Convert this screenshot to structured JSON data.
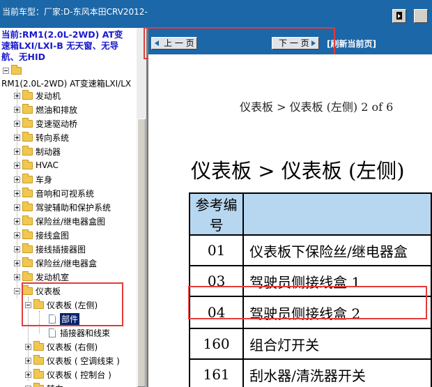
{
  "header": {
    "model_label": "当前车型：",
    "model_value": "厂家:D-东风本田CRV2012-"
  },
  "tree": {
    "vehicle_lines": [
      "当前:RM1(2.0L-2WD) AT变",
      "速箱LXI/LXI-B 无天窗、无导",
      "航、无HID"
    ],
    "root_label": "RM1(2.0L-2WD) AT变速箱LXI/LX",
    "items": [
      {
        "label": "发动机"
      },
      {
        "label": "燃油和排放"
      },
      {
        "label": "变速驱动桥"
      },
      {
        "label": "转向系统"
      },
      {
        "label": "制动器"
      },
      {
        "label": "HVAC"
      },
      {
        "label": "车身"
      },
      {
        "label": "音响和可视系统"
      },
      {
        "label": "驾驶辅助和保护系统"
      },
      {
        "label": "保险丝/继电器盒图"
      },
      {
        "label": "接线盒图"
      },
      {
        "label": "接线插接器图"
      },
      {
        "label": "保险丝/继电器盒"
      },
      {
        "label": "发动机室"
      },
      {
        "label": "仪表板"
      }
    ],
    "sub_group": "仪表板 (左侧)",
    "leaf_selected": "部件",
    "leaf_other": "插接器和线束",
    "siblings": [
      {
        "label": "仪表板 (右侧)"
      },
      {
        "label": "仪表板 ( 空调线束 )"
      },
      {
        "label": "仪表板 ( 控制台 )"
      },
      {
        "label": "转向"
      }
    ]
  },
  "nav": {
    "prev_label": "上 一 页",
    "next_label": "下 一 页",
    "refresh_label": "[刷新当前页]"
  },
  "content": {
    "breadcrumb": "仪表板 > 仪表板 (左侧)  2 of 6",
    "page_title": "仪表板 > 仪表板 (左侧)",
    "table_header": [
      "参考编号",
      ""
    ],
    "rows": [
      {
        "ref": "01",
        "name": "仪表板下保险丝/继电器盒"
      },
      {
        "ref": "03",
        "name": "驾驶员侧接线盒 1"
      },
      {
        "ref": "04",
        "name": "驾驶员侧接线盒 2"
      },
      {
        "ref": "160",
        "name": "组合灯开关"
      },
      {
        "ref": "161",
        "name": "刮水器/清洗器开关"
      }
    ]
  },
  "colors": {
    "header_blue": "#1c67a7",
    "table_header_bg": "#b7d7f0",
    "highlight_red": "#e43a3a",
    "tree_vehicle_text": "#1a1acc"
  }
}
